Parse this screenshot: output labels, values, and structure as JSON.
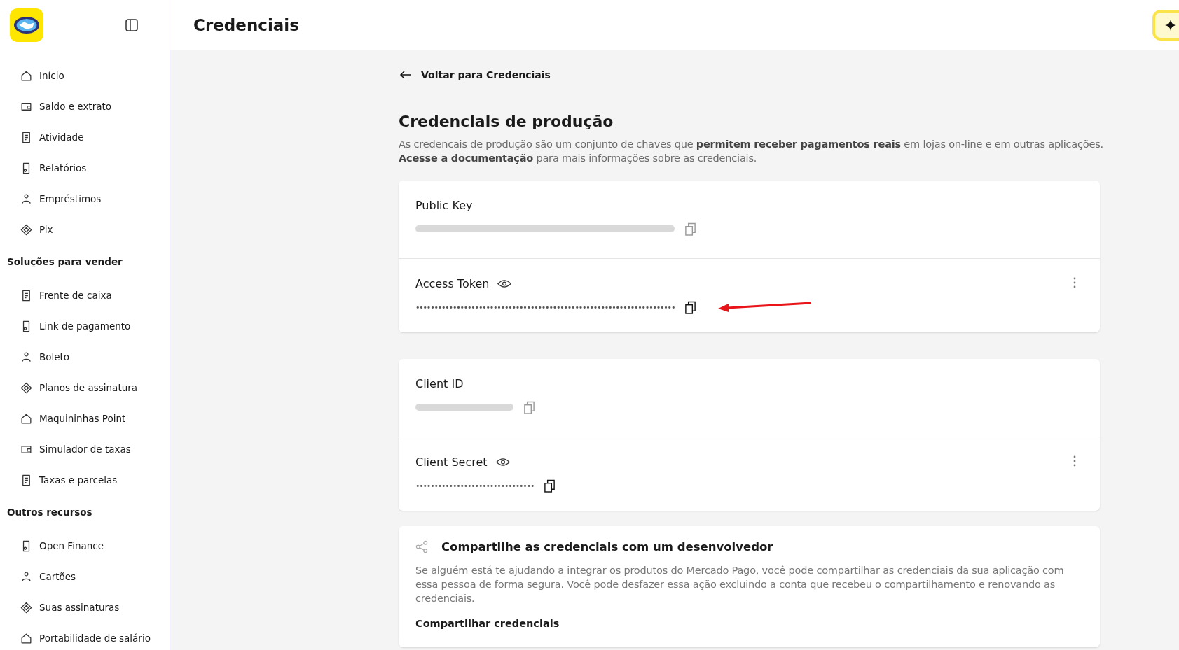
{
  "header": {
    "title": "Credenciais"
  },
  "sidebar": {
    "items": [
      {
        "label": "Início"
      },
      {
        "label": "Saldo e extrato"
      },
      {
        "label": "Atividade"
      },
      {
        "label": "Relatórios"
      },
      {
        "label": "Empréstimos"
      },
      {
        "label": "Pix"
      }
    ],
    "sections": [
      {
        "title": "Soluções para vender",
        "items": [
          {
            "label": "Frente de caixa"
          },
          {
            "label": "Link de pagamento"
          },
          {
            "label": "Boleto"
          },
          {
            "label": "Planos de assinatura"
          },
          {
            "label": "Maquininhas Point"
          },
          {
            "label": "Simulador de taxas"
          },
          {
            "label": "Taxas e parcelas"
          }
        ]
      },
      {
        "title": "Outros recursos",
        "items": [
          {
            "label": "Open Finance"
          },
          {
            "label": "Cartões"
          },
          {
            "label": "Suas assinaturas"
          },
          {
            "label": "Portabilidade de salário"
          }
        ]
      }
    ]
  },
  "back_link": "Voltar para Credenciais",
  "heading": "Credenciais de produção",
  "description": [
    "As credencais de produção são um conjunto de chaves que **permitem receber pagamentos reais** em lojas on-line e em outras aplicações.",
    "**Acesse a documentação** para mais informações sobre as credenciais."
  ],
  "cards": [
    {
      "rows": [
        {
          "label": "Public Key",
          "kind": "blurred",
          "eye": false,
          "menu": false
        },
        {
          "label": "Access Token",
          "kind": "masked",
          "value": "••••••••••••••••••••••••••••••••••••••••••••••••••••••••••••••••••••••",
          "eye": true,
          "menu": true
        }
      ]
    },
    {
      "rows": [
        {
          "label": "Client ID",
          "kind": "blurred",
          "eye": false,
          "menu": false
        },
        {
          "label": "Client Secret",
          "kind": "masked",
          "value": "••••••••••••••••••••••••••••••••",
          "eye": true,
          "menu": true
        }
      ]
    }
  ],
  "share": {
    "title": "Compartilhe as credenciais com um desenvolvedor",
    "text": "Se alguém está te ajudando a integrar os produtos do Mercado Pago, você pode compartilhar as credenciais da sua aplicação com essa pessoa de forma segura. Você pode desfazer essa ação excluindo a conta que recebeu o compartilhamento e renovando as credenciais.",
    "action": "Compartilhar credenciais"
  }
}
